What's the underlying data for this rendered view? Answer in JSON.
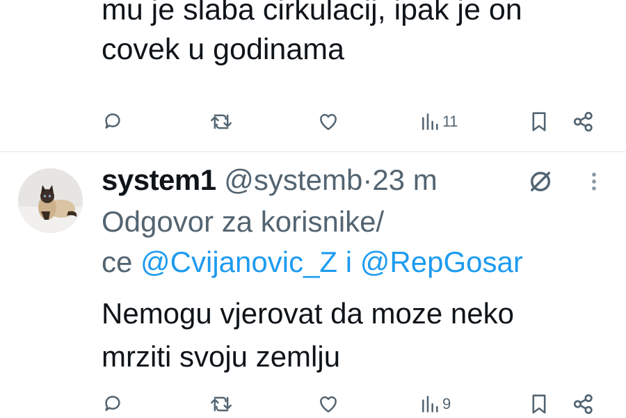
{
  "previous_tweet": {
    "text_line1": "mu je slaba cirkulacij, ipak je on",
    "text_line2": "covek u godinama",
    "views": "11"
  },
  "tweet": {
    "display_name": "system1",
    "handle": "@systemb",
    "separator": "·",
    "time": "23 m",
    "reply_prefix": "Odgovor za korisnike/",
    "reply_ce": "ce",
    "mention1": "@Cvijanovic_Z",
    "reply_and": "i",
    "mention2": "@RepGosar",
    "text_line1": "Nemogu vjerovat da moze neko",
    "text_line2": "mrziti svoju zemlju",
    "views": "9"
  },
  "icons": {
    "reply": "reply-icon",
    "retweet": "retweet-icon",
    "like": "heart-icon",
    "views": "views-icon",
    "bookmark": "bookmark-icon",
    "share": "share-icon",
    "grok": "grok-icon",
    "more": "more-icon"
  },
  "colors": {
    "text": "#0f1419",
    "secondary": "#536471",
    "link": "#1d9bf0",
    "divider": "#eff3f4"
  }
}
